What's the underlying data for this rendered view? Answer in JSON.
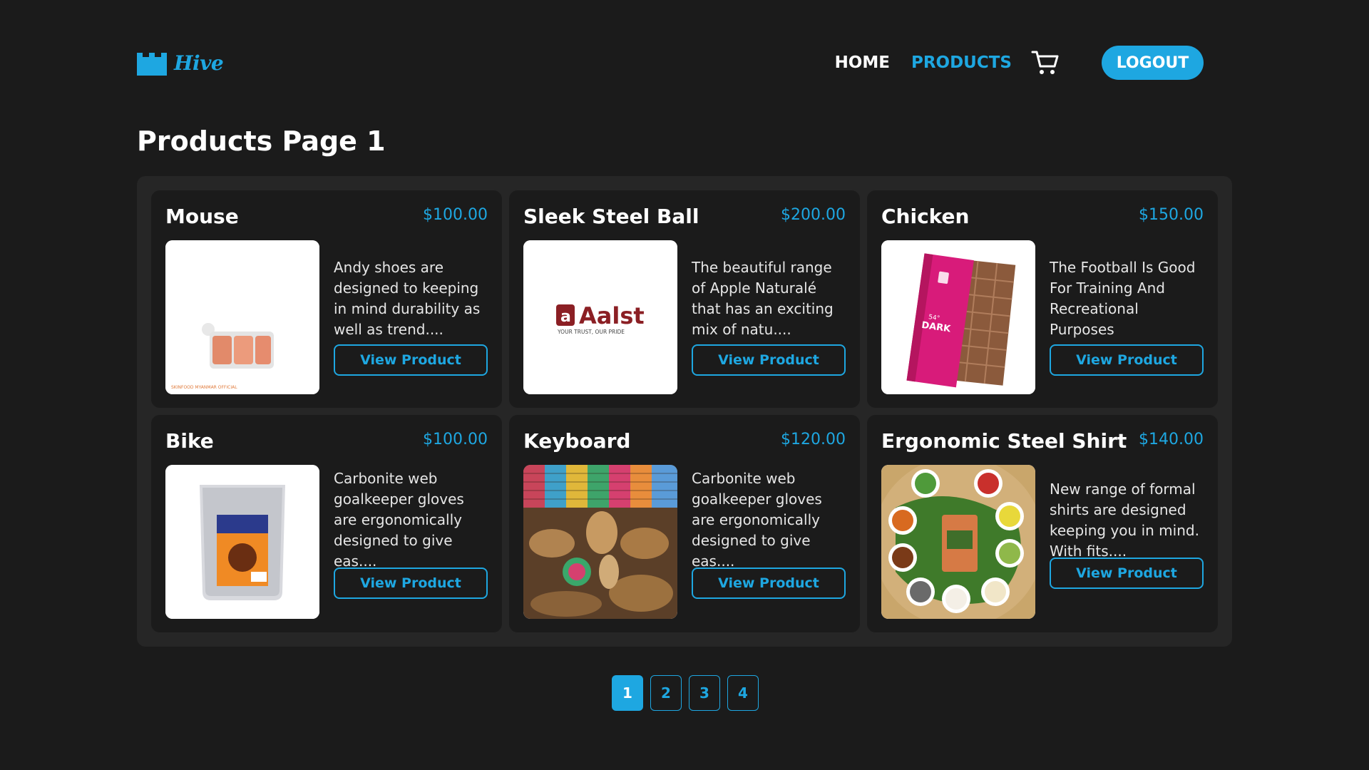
{
  "brand": {
    "name": "Hive",
    "accent": "#1ea7e1"
  },
  "nav": {
    "home": "HOME",
    "products": "PRODUCTS",
    "cart_icon": "shopping-cart-icon",
    "logout": "LOGOUT"
  },
  "page_title": "Products Page 1",
  "products": [
    {
      "name": "Mouse",
      "price": "$100.00",
      "description": "Andy shoes are designed to keeping in mind durability as well as trend....",
      "button": "View Product",
      "image_icon": "cosmetic-tray-image",
      "image_caption": "SKINFOOD MYANMAR OFFICIAL"
    },
    {
      "name": "Sleek Steel Ball",
      "price": "$200.00",
      "description": "The beautiful range of Apple Naturalé that has an exciting mix of natu....",
      "button": "View Product",
      "image_icon": "aalst-logo-image",
      "image_logo_text": "Aalst",
      "image_tagline": "YOUR TRUST, OUR PRIDE"
    },
    {
      "name": "Chicken",
      "price": "$150.00",
      "description": "The Football Is Good For Training And Recreational Purposes",
      "button": "View Product",
      "image_icon": "chocolate-bar-image",
      "image_label": "DARK",
      "image_percent": "54°"
    },
    {
      "name": "Bike",
      "price": "$100.00",
      "description": "Carbonite web goalkeeper gloves are ergonomically designed to give eas....",
      "button": "View Product",
      "image_icon": "food-pouch-image"
    },
    {
      "name": "Keyboard",
      "price": "$120.00",
      "description": "Carbonite web goalkeeper gloves are ergonomically designed to give eas....",
      "button": "View Product",
      "image_icon": "woven-baskets-image"
    },
    {
      "name": "Ergonomic Steel Shirt",
      "price": "$140.00",
      "description": "New range of formal shirts are designed keeping you in mind. With fits....",
      "button": "View Product",
      "image_icon": "food-platter-image"
    }
  ],
  "pagination": {
    "pages": [
      "1",
      "2",
      "3",
      "4"
    ],
    "current": "1"
  }
}
